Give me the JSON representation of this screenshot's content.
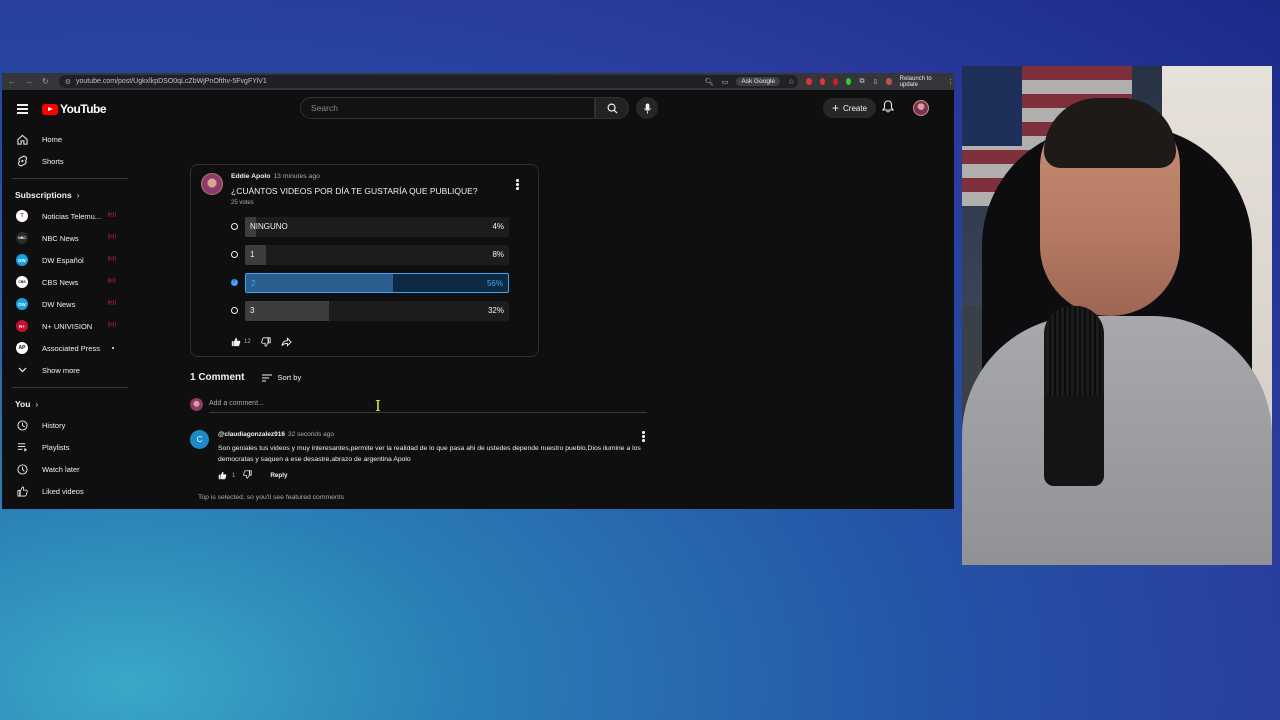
{
  "browser": {
    "url": "youtube.com/post/UgkxlkpDSO0qLcZbWjPnOfthv-5FvgFYiV1",
    "ask_google": "Ask Google",
    "relaunch": "Relaunch to update"
  },
  "header": {
    "logo_text": "YouTube",
    "search_placeholder": "Search",
    "create_label": "Create"
  },
  "sidebar": {
    "main": [
      {
        "label": "Home",
        "icon": "home-icon"
      },
      {
        "label": "Shorts",
        "icon": "shorts-icon"
      }
    ],
    "subscriptions_title": "Subscriptions",
    "subscriptions": [
      {
        "label": "Noticias Telemu...",
        "avatar": "T",
        "color": "#ffffff",
        "status": "live"
      },
      {
        "label": "NBC News",
        "avatar": "NBC",
        "color": "#2b2b2b",
        "status": "live"
      },
      {
        "label": "DW Español",
        "avatar": "DW",
        "color": "#19a1e6",
        "status": "live"
      },
      {
        "label": "CBS News",
        "avatar": "CBS",
        "color": "#ffffff",
        "status": "live"
      },
      {
        "label": "DW News",
        "avatar": "DW",
        "color": "#19a1e6",
        "status": "live"
      },
      {
        "label": "N+ UNIVISION",
        "avatar": "N+",
        "color": "#c8102e",
        "status": "live"
      },
      {
        "label": "Associated Press",
        "avatar": "AP",
        "color": "#ffffff",
        "status": "new"
      }
    ],
    "show_more": "Show more",
    "you_title": "You",
    "you": [
      {
        "label": "History",
        "icon": "history-icon"
      },
      {
        "label": "Playlists",
        "icon": "playlists-icon"
      },
      {
        "label": "Watch later",
        "icon": "watch-later-icon"
      },
      {
        "label": "Liked videos",
        "icon": "liked-videos-icon"
      }
    ]
  },
  "post": {
    "author": "Eddie Apolo",
    "time": "13 minutes ago",
    "question": "¿CUÁNTOS VIDEOS POR DÍA TE GUSTARÍA QUE PUBLIQUE?",
    "votes": "25 votes",
    "options": [
      {
        "label": "NINGUNO",
        "percent_text": "4%",
        "percent": 4,
        "selected": false
      },
      {
        "label": "1",
        "percent_text": "8%",
        "percent": 8,
        "selected": false
      },
      {
        "label": "2",
        "percent_text": "56%",
        "percent": 56,
        "selected": true
      },
      {
        "label": "3",
        "percent_text": "32%",
        "percent": 32,
        "selected": false
      }
    ],
    "likes": "12"
  },
  "comments": {
    "count_label": "1 Comment",
    "sort_label": "Sort by",
    "add_placeholder": "Add a comment...",
    "items": [
      {
        "author": "@claudiagonzalez916",
        "time": "32 seconds ago",
        "avatar_letter": "C",
        "text": "Son geniales tus videos y muy interesantes,permite ver la realidad de lo que  pasa ahi de ustedes depende nuestro pueblo,Dios ilumine a los  democratas y saquen a ese desastre,abrazo de argentina  Apolo",
        "likes": "1",
        "reply_label": "Reply"
      }
    ],
    "featured_note": "Top is selected, so you'll see featured comments"
  },
  "colors": {
    "accent": "#3ea6ff",
    "brand": "#ff0000",
    "live": "#dd3333"
  }
}
